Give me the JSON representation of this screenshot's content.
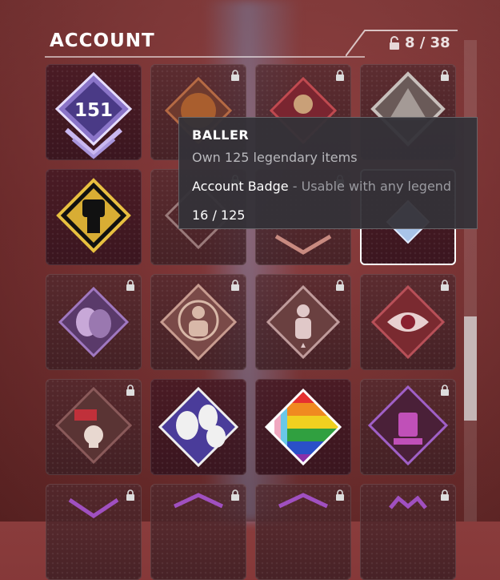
{
  "header": {
    "title": "ACCOUNT",
    "counter": "8 / 38"
  },
  "tooltip": {
    "title": "BALLER",
    "description": "Own 125 legendary items",
    "type_label": "Account Badge",
    "type_separator": " - ",
    "type_detail": "Usable with any legend",
    "progress": "16 / 125"
  },
  "badges": [
    {
      "name": "level-badge",
      "text": "151",
      "locked": false
    },
    {
      "name": "baller-badge",
      "locked": true
    },
    {
      "name": "helmet-badge",
      "locked": true
    },
    {
      "name": "apex-logo-badge",
      "locked": true
    },
    {
      "name": "raised-fist-badge",
      "locked": false
    },
    {
      "name": "badge-row2-col2",
      "locked": true
    },
    {
      "name": "badge-row2-col3",
      "locked": true
    },
    {
      "name": "badge-row2-col4",
      "locked": false,
      "selected": true
    },
    {
      "name": "theater-masks-badge",
      "locked": true
    },
    {
      "name": "target-figure-badge",
      "locked": true
    },
    {
      "name": "squad-badge",
      "locked": true
    },
    {
      "name": "eye-badge",
      "locked": true
    },
    {
      "name": "skull-flag-badge",
      "locked": true
    },
    {
      "name": "dogs-badge",
      "locked": false
    },
    {
      "name": "pride-flag-badge",
      "locked": false
    },
    {
      "name": "purple-emblem-badge",
      "locked": true
    }
  ],
  "colors": {
    "accent_purple": "#a06ad0",
    "gold": "#d8ad34",
    "tooltip_bg": "#343238"
  }
}
